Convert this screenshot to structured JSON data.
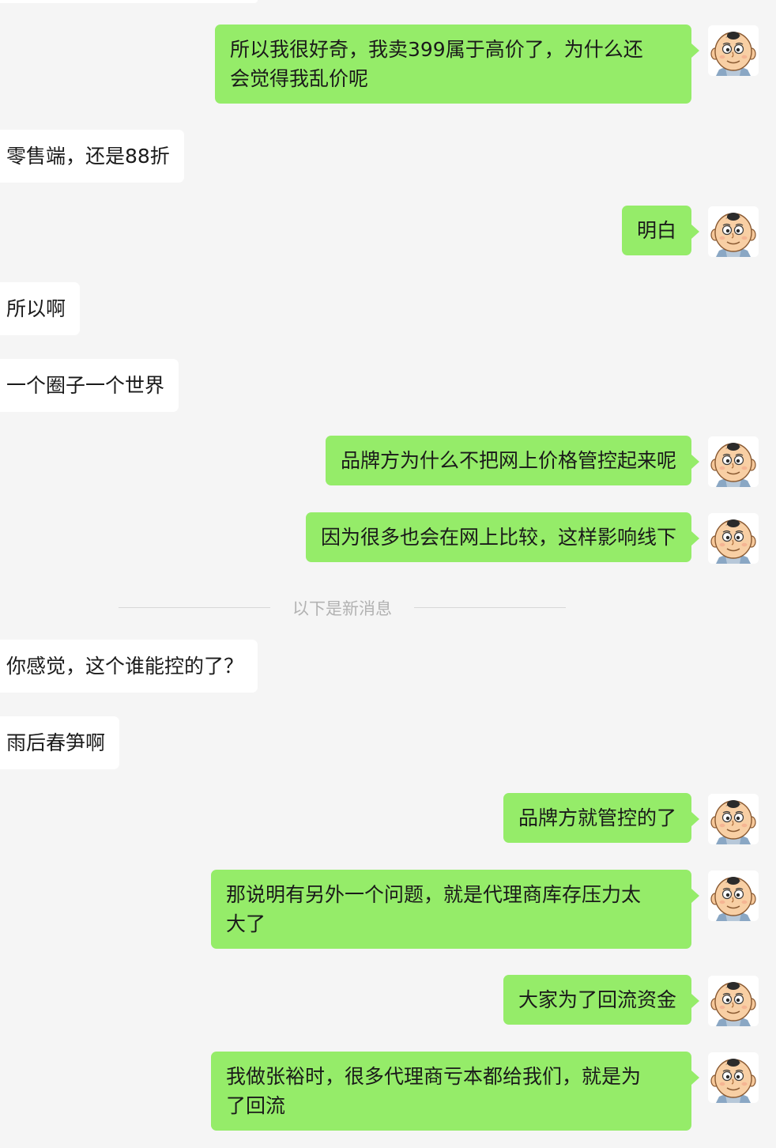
{
  "messages": [
    {
      "side": "right",
      "text": "所以我很好奇，我卖399属于高价了，为什么还\n会觉得我乱价呢"
    },
    {
      "side": "left",
      "text": "零售端，还是88折"
    },
    {
      "side": "right",
      "text": "明白"
    },
    {
      "side": "left",
      "text": "所以啊"
    },
    {
      "side": "left",
      "text": "一个圈子一个世界"
    },
    {
      "side": "right",
      "text": "品牌方为什么不把网上价格管控起来呢"
    },
    {
      "side": "right",
      "text": "因为很多也会在网上比较，这样影响线下"
    },
    {
      "side": "left",
      "text": "你感觉，这个谁能控的了？"
    },
    {
      "side": "left",
      "text": "雨后春笋啊"
    },
    {
      "side": "right",
      "text": "品牌方就管控的了"
    },
    {
      "side": "right",
      "text": "那说明有另外一个问题，就是代理商库存压力太\n大了"
    },
    {
      "side": "right",
      "text": "大家为了回流资金"
    },
    {
      "side": "right",
      "text": "我做张裕时，很多代理商亏本都给我们，就是为\n了回流"
    }
  ],
  "divider": {
    "label": "以下是新消息"
  },
  "colors": {
    "background": "#f5f5f5",
    "sent_bubble": "#95ec69",
    "received_bubble": "#ffffff",
    "divider_text": "#b2b2b2"
  },
  "icons": {
    "avatar": "cartoon-baby-avatar-icon"
  }
}
